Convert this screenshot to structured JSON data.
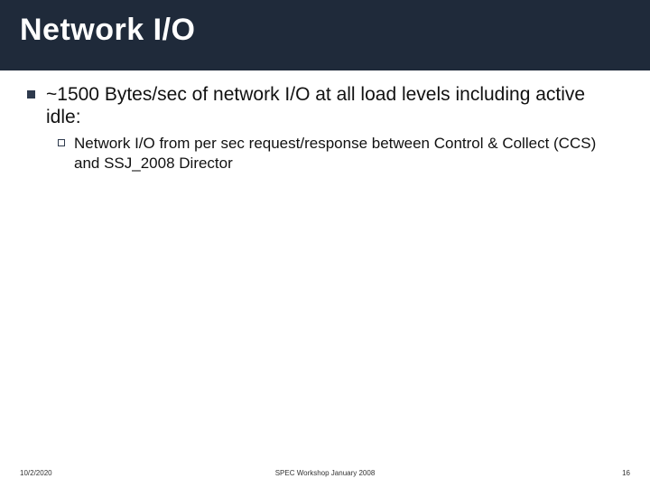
{
  "title": "Network I/O",
  "bullets": {
    "main": "~1500 Bytes/sec of network I/O at all load levels including active idle:",
    "sub": "Network I/O from per sec request/response between Control & Collect (CCS) and SSJ_2008 Director"
  },
  "footer": {
    "date": "10/2/2020",
    "center": "SPEC Workshop January 2008",
    "page": "16"
  }
}
